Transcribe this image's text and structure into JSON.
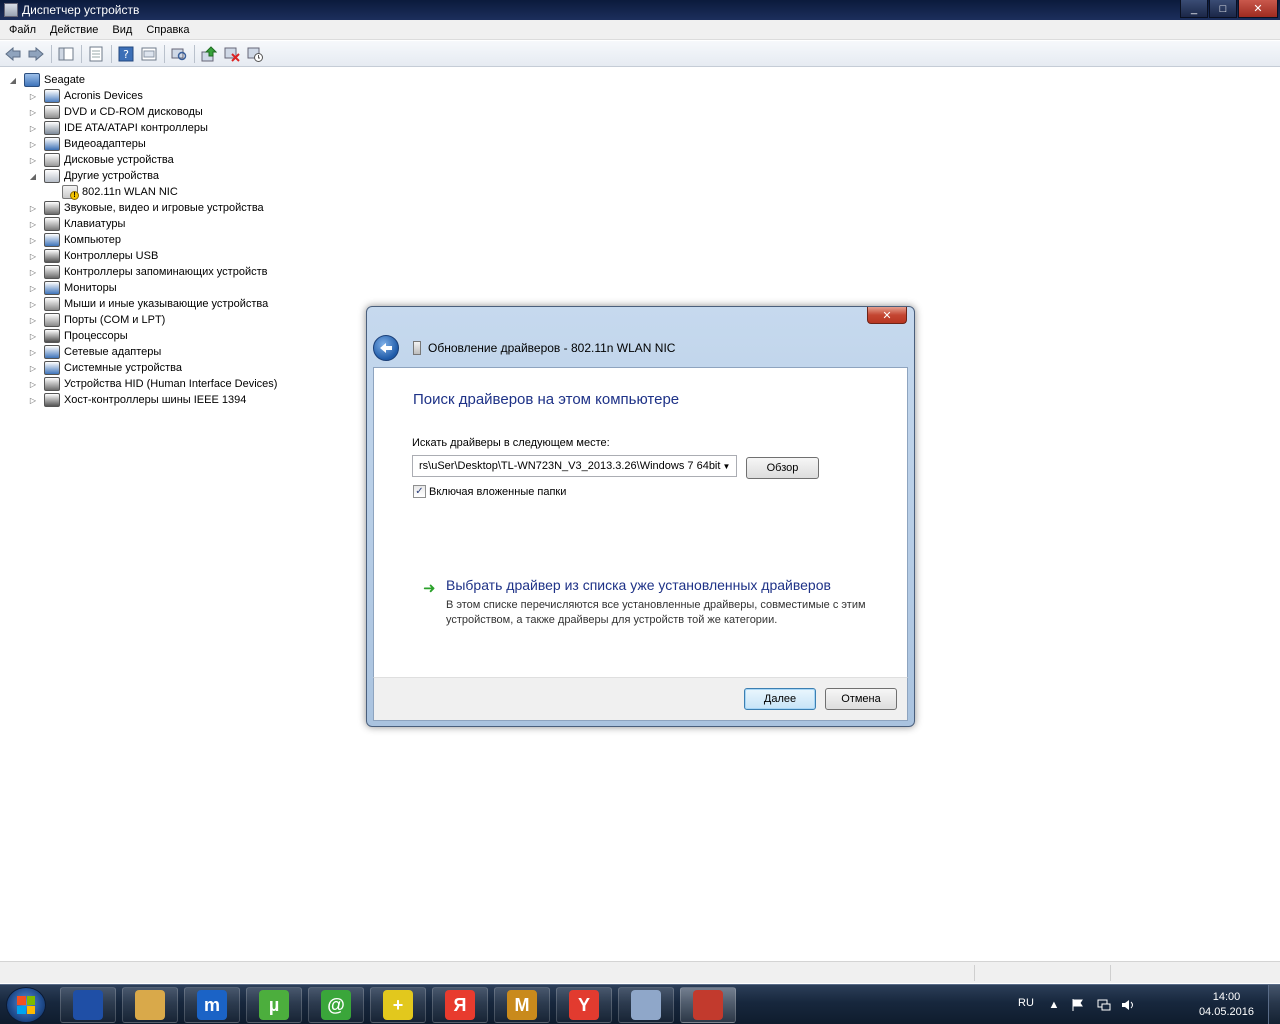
{
  "window": {
    "title": "Диспетчер устройств",
    "controls": [
      "_",
      "□",
      "✕"
    ]
  },
  "menu": [
    "Файл",
    "Действие",
    "Вид",
    "Справка"
  ],
  "toolbar": {
    "icons": [
      "back-arrow-icon",
      "forward-arrow-icon",
      "show-hide-tree-icon",
      "properties-icon",
      "help-icon",
      "properties-sheet-icon",
      "scan-hardware-icon",
      "update-driver-icon",
      "disable-device-icon",
      "uninstall-device-icon"
    ]
  },
  "tree": {
    "root": "Seagate",
    "items": [
      {
        "label": "Acronis Devices",
        "icon": "device-icon",
        "color": "#4a7dc0"
      },
      {
        "label": "DVD и CD-ROM дисководы",
        "icon": "disc-drive-icon",
        "color": "#8e8e8e"
      },
      {
        "label": "IDE ATA/ATAPI контроллеры",
        "icon": "ide-controller-icon",
        "color": "#7d8a99"
      },
      {
        "label": "Видеоадаптеры",
        "icon": "display-adapter-icon",
        "color": "#3b6fb5"
      },
      {
        "label": "Дисковые устройства",
        "icon": "disk-drive-icon",
        "color": "#9a9a9a"
      },
      {
        "label": "Другие устройства",
        "icon": "other-devices-icon",
        "color": "#b7bec8",
        "expanded": true
      },
      {
        "label": "Звуковые, видео и игровые устройства",
        "icon": "sound-icon",
        "color": "#6c6c6c"
      },
      {
        "label": "Клавиатуры",
        "icon": "keyboard-icon",
        "color": "#7a7a7a"
      },
      {
        "label": "Компьютер",
        "icon": "computer-icon",
        "color": "#3f74ba"
      },
      {
        "label": "Контроллеры USB",
        "icon": "usb-icon",
        "color": "#555555"
      },
      {
        "label": "Контроллеры запоминающих устройств",
        "icon": "storage-controller-icon",
        "color": "#6a6a6a"
      },
      {
        "label": "Мониторы",
        "icon": "monitor-icon",
        "color": "#3f74ba"
      },
      {
        "label": "Мыши и иные указывающие устройства",
        "icon": "mouse-icon",
        "color": "#8a8a8a"
      },
      {
        "label": "Порты (COM и LPT)",
        "icon": "port-icon",
        "color": "#8a8a8a"
      },
      {
        "label": "Процессоры",
        "icon": "processor-icon",
        "color": "#4d4d4d"
      },
      {
        "label": "Сетевые адаптеры",
        "icon": "network-adapter-icon",
        "color": "#3f74ba"
      },
      {
        "label": "Системные устройства",
        "icon": "system-devices-icon",
        "color": "#3f74ba"
      },
      {
        "label": "Устройства HID (Human Interface Devices)",
        "icon": "hid-icon",
        "color": "#6d6d6d"
      },
      {
        "label": "Хост-контроллеры шины IEEE 1394",
        "icon": "ieee1394-icon",
        "color": "#555555"
      }
    ],
    "child": {
      "label": "802.11n WLAN NIC",
      "icon": "unknown-device-warning-icon",
      "parent_index": 5
    }
  },
  "dialog": {
    "title": "Обновление драйверов - 802.11n WLAN NIC",
    "close": "✕",
    "heading": "Поиск драйверов на этом компьютере",
    "path_label": "Искать драйверы в следующем месте:",
    "path_value": "rs\\uSer\\Desktop\\TL-WN723N_V3_2013.3.26\\Windows 7 64bit",
    "browse": "Обзор",
    "include_subfolders": "Включая вложенные папки",
    "include_subfolders_checked": true,
    "link_title": "Выбрать драйвер из списка уже установленных драйверов",
    "link_desc": "В этом списке перечисляются все установленные драйверы, совместимые с этим устройством, а также драйверы для устройств той же категории.",
    "next": "Далее",
    "cancel": "Отмена"
  },
  "taskbar": {
    "apps": [
      {
        "name": "save-app-icon",
        "label": "",
        "color": "#1f4fa6"
      },
      {
        "name": "file-manager-icon",
        "label": "",
        "color": "#d9a94a"
      },
      {
        "name": "maxthon-icon",
        "label": "m",
        "color": "#1b63c6"
      },
      {
        "name": "utorrent-icon",
        "label": "µ",
        "color": "#4cae3d"
      },
      {
        "name": "mail-agent-icon",
        "label": "@",
        "color": "#3aa63a"
      },
      {
        "name": "add-app-icon",
        "label": "+",
        "color": "#e2c81d"
      },
      {
        "name": "yandex-icon",
        "label": "Я",
        "color": "#e83b2e"
      },
      {
        "name": "m-app-icon",
        "label": "M",
        "color": "#c98a1c"
      },
      {
        "name": "yandex-browser-icon",
        "label": "Y",
        "color": "#e23b2f"
      },
      {
        "name": "paint-icon",
        "label": "",
        "color": "#8fa7c9"
      },
      {
        "name": "device-manager-taskbar-icon",
        "label": "",
        "color": "#c23a2d"
      }
    ],
    "lang": "RU",
    "time": "14:00",
    "date": "04.05.2016"
  }
}
